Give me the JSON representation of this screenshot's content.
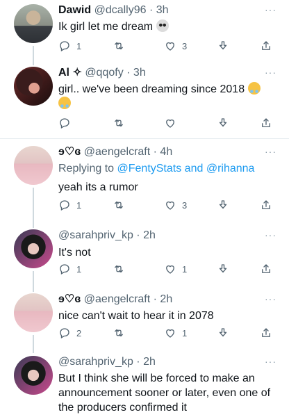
{
  "tweets": [
    {
      "name": "Dawid",
      "handle": "@dcally96",
      "time": "· 3h",
      "text": "Ik girl let me dream",
      "emoji_icon": "skull-emoji",
      "replies": "1",
      "retweets": "",
      "likes": "3"
    },
    {
      "name": "Al ✧",
      "handle": "@qqofy",
      "time": "· 3h",
      "text": "girl.. we've been dreaming since 2018",
      "emoji_icon": "crying-face-emoji",
      "replies": "",
      "retweets": "",
      "likes": ""
    },
    {
      "name": "ɘ♡ɞ",
      "handle": "@aengelcraft",
      "time": "· 4h",
      "replying_prefix": "Replying to",
      "replying_user1": "@FentyStats",
      "replying_and": "and",
      "replying_user2": "@rihanna",
      "text": "yeah its a rumor",
      "replies": "1",
      "retweets": "",
      "likes": "3"
    },
    {
      "name": "",
      "handle": "@sarahpriv_kp",
      "time": "· 2h",
      "text": "It's not",
      "replies": "1",
      "retweets": "",
      "likes": "1"
    },
    {
      "name": "ɘ♡ɞ",
      "handle": "@aengelcraft",
      "time": "· 2h",
      "text": "nice can't wait to hear it in 2078",
      "replies": "2",
      "retweets": "",
      "likes": "1"
    },
    {
      "name": "",
      "handle": "@sarahpriv_kp",
      "time": "· 2h",
      "text": "But I think she will be forced to make an announcement sooner or later, even one of the producers confirmed it"
    }
  ],
  "more_label": "···",
  "colors": {
    "accent": "#1d9bf0",
    "muted": "#536471",
    "divider": "#e6ecf0"
  }
}
